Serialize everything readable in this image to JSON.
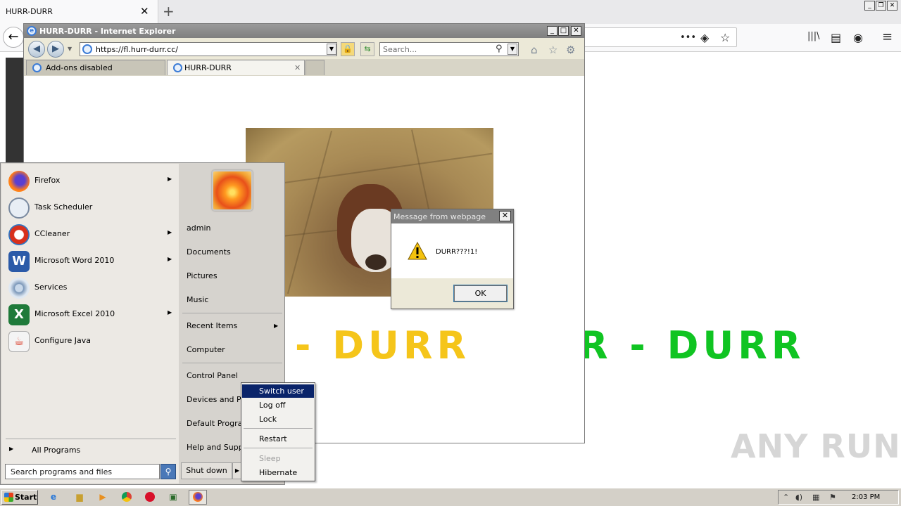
{
  "firefox": {
    "tab_title": "HURR-DURR",
    "tab_close": "✕",
    "new_tab": "+",
    "back": "←",
    "url_more": "•••",
    "url_pocket": "◈",
    "url_star": "☆",
    "library": "|||\\",
    "sidebar": "▤",
    "account": "◉",
    "menu": "≡",
    "win_controls": [
      "_",
      "❐",
      "✕"
    ]
  },
  "ie": {
    "window_title": "HURR-DURR - Internet Explorer",
    "logo": "e",
    "address": "https://fl.hurr-durr.cc/",
    "search_placeholder": "Search...",
    "tabs": [
      {
        "label": "Add-ons disabled"
      },
      {
        "label": "HURR-DURR",
        "close": "✕"
      }
    ],
    "win_controls": [
      "_",
      "□",
      "✕"
    ],
    "tools": [
      "⌂",
      "☆",
      "⚙"
    ]
  },
  "page": {
    "durr_left": "- DURR",
    "durr_right": "R - DURR",
    "colors": {
      "yellow": "#f5c51a",
      "green": "#10c422"
    }
  },
  "message_box": {
    "title": "Message from webpage",
    "close": "✕",
    "icon": "warning-icon",
    "text": "DURR???!1!",
    "ok": "OK"
  },
  "start_menu": {
    "programs": [
      {
        "label": "Firefox",
        "icon": "firefox-icon",
        "arrow": true
      },
      {
        "label": "Task Scheduler",
        "icon": "clock-icon",
        "arrow": false
      },
      {
        "label": "CCleaner",
        "icon": "ccleaner-icon",
        "arrow": true
      },
      {
        "label": "Microsoft Word 2010",
        "icon": "word-icon",
        "arrow": true
      },
      {
        "label": "Services",
        "icon": "gears-icon",
        "arrow": false
      },
      {
        "label": "Microsoft Excel 2010",
        "icon": "excel-icon",
        "arrow": true
      },
      {
        "label": "Configure Java",
        "icon": "java-icon",
        "arrow": false
      }
    ],
    "all_programs": "All Programs",
    "search_placeholder": "Search programs and files",
    "right": {
      "user": "admin",
      "documents": "Documents",
      "pictures": "Pictures",
      "music": "Music",
      "recent_items": "Recent Items",
      "computer": "Computer",
      "control_panel": "Control Panel",
      "devices": "Devices and Pri",
      "default_programs": "Default Prograi",
      "help": "Help and Suppo"
    },
    "shutdown": "Shut down",
    "shutdown_menu": [
      {
        "label": "Switch user",
        "state": "selected"
      },
      {
        "label": "Log off",
        "state": "normal"
      },
      {
        "label": "Lock",
        "state": "normal"
      },
      {
        "label": "Restart",
        "state": "normal"
      },
      {
        "label": "Sleep",
        "state": "disabled"
      },
      {
        "label": "Hibernate",
        "state": "normal"
      }
    ]
  },
  "taskbar": {
    "start": "Start",
    "time": "2:03 PM",
    "icons": [
      "ie-icon",
      "folder-icon",
      "media-icon",
      "chrome-icon",
      "opera-icon",
      "terminal-icon",
      "firefox-icon"
    ]
  },
  "watermark": "ANY  RUN"
}
